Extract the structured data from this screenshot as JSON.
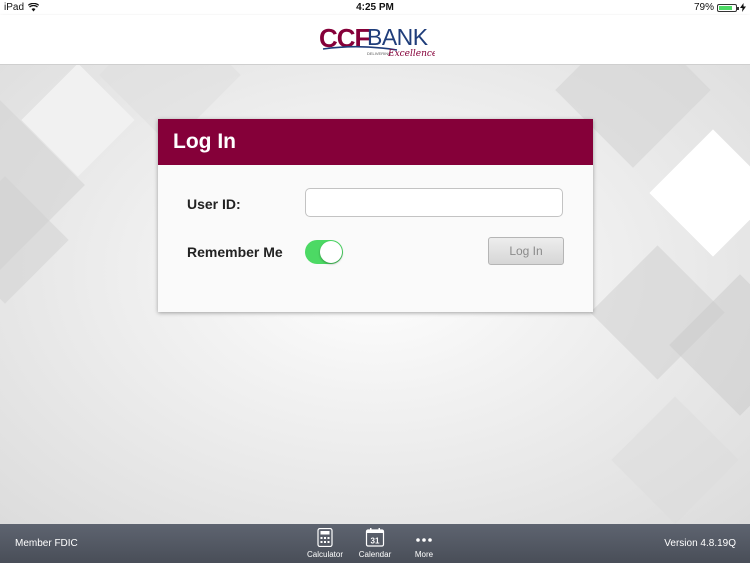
{
  "status_bar": {
    "carrier": "iPad",
    "time": "4:25 PM",
    "battery_percent": "79%",
    "battery_level": 0.79,
    "icons": [
      "wifi-icon",
      "battery-icon",
      "charging-icon"
    ]
  },
  "header": {
    "logo": {
      "primary": "CCF",
      "secondary": "BANK",
      "tagline_small": "DELIVERING",
      "tagline": "Excellence"
    }
  },
  "login_card": {
    "title": "Log In",
    "user_id_label": "User ID:",
    "user_id_value": "",
    "user_id_placeholder": "",
    "remember_label": "Remember Me",
    "remember_on": true,
    "login_button": "Log In"
  },
  "footer": {
    "member": "Member FDIC",
    "version": "Version 4.8.19Q",
    "tools": [
      {
        "label": "Calculator",
        "icon": "calculator-icon"
      },
      {
        "label": "Calendar",
        "icon": "calendar-icon",
        "day": "31"
      },
      {
        "label": "More",
        "icon": "more-icon"
      }
    ]
  },
  "colors": {
    "brand_maroon": "#850039",
    "logo_navy": "#1f3d7a",
    "toggle_green": "#4cd964",
    "bar_gray": "#545a64"
  }
}
